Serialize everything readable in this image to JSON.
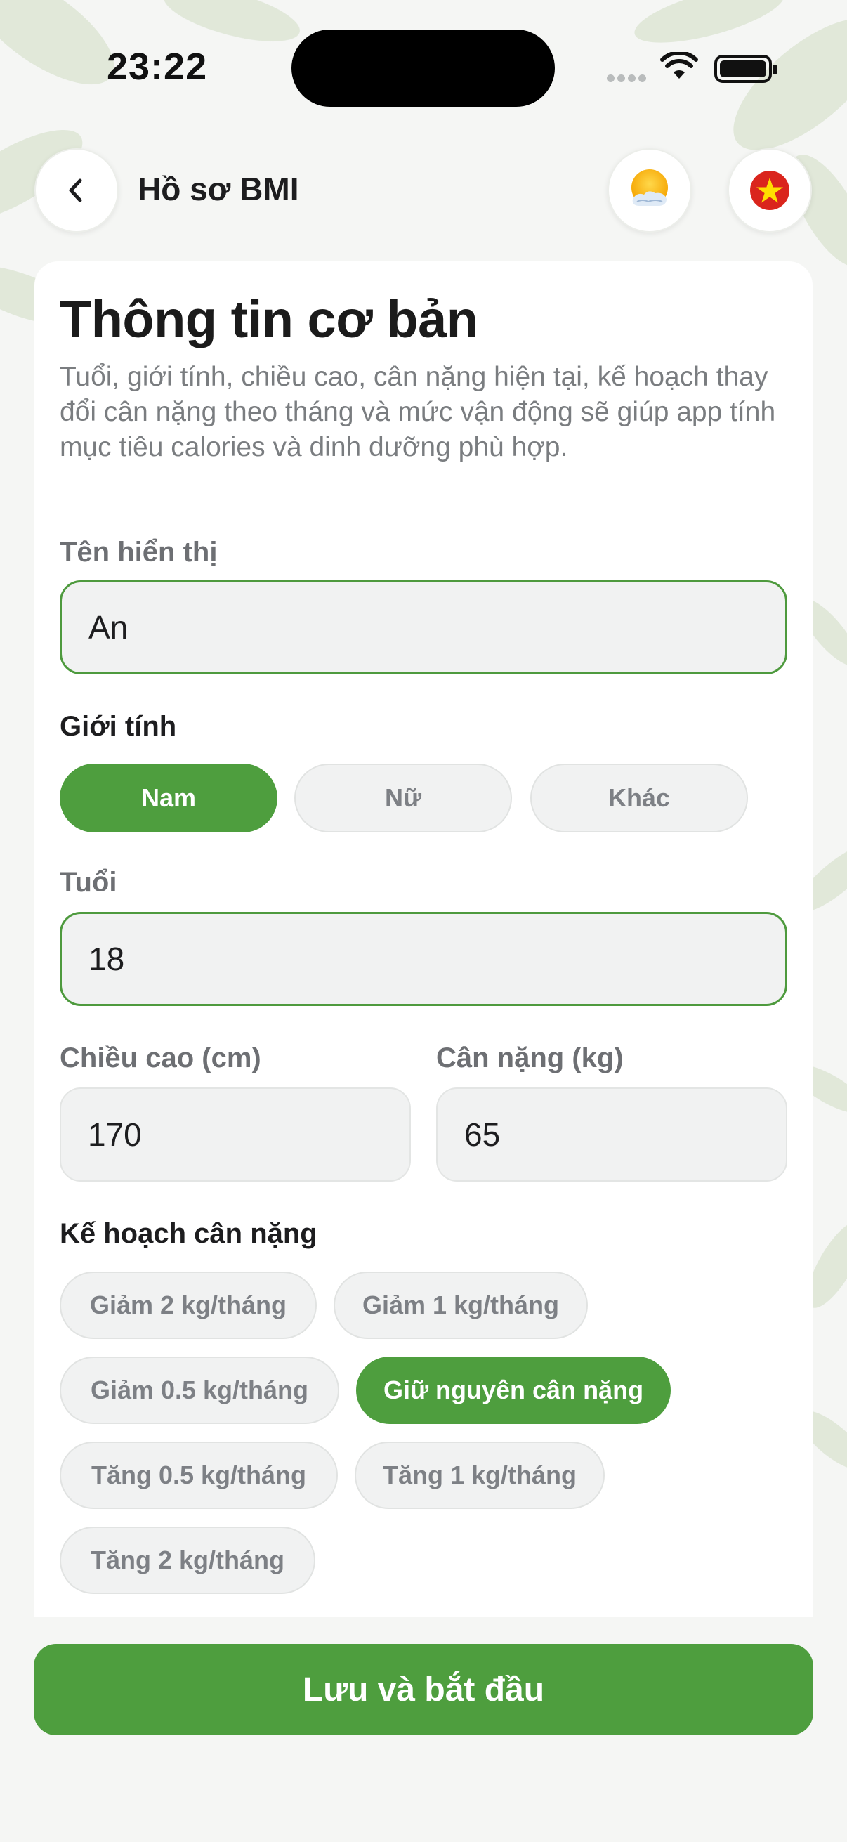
{
  "status_bar": {
    "time": "23:22"
  },
  "header": {
    "title": "Hồ sơ BMI"
  },
  "section": {
    "title": "Thông tin cơ bản",
    "description": "Tuổi, giới tính, chiều cao, cân nặng hiện tại, kế hoạch thay đổi cân nặng theo tháng và mức vận động sẽ giúp app tính mục tiêu calories và dinh dưỡng phù hợp."
  },
  "display_name": {
    "label": "Tên hiển thị",
    "value": "An"
  },
  "gender": {
    "label": "Giới tính",
    "options": [
      "Nam",
      "Nữ",
      "Khác"
    ],
    "selected": "Nam"
  },
  "age": {
    "label": "Tuổi",
    "value": "18"
  },
  "height": {
    "label": "Chiều cao (cm)",
    "value": "170"
  },
  "weight": {
    "label": "Cân nặng (kg)",
    "value": "65"
  },
  "weight_plan": {
    "label": "Kế hoạch cân nặng",
    "options": [
      "Giảm 2 kg/tháng",
      "Giảm 1 kg/tháng",
      "Giảm 0.5 kg/tháng",
      "Giữ nguyên cân nặng",
      "Tăng 0.5 kg/tháng",
      "Tăng 1 kg/tháng",
      "Tăng 2 kg/tháng"
    ],
    "selected": "Giữ nguyên cân nặng"
  },
  "save_button": {
    "label": "Lưu và bắt đầu"
  },
  "colors": {
    "accent": "#4e9e3e",
    "border_active": "#4e9a3e",
    "flag_red": "#da251d",
    "flag_star": "#ffde00"
  },
  "icons": {
    "back": "chevron-left-icon",
    "theme": "sun-cloud-icon",
    "language": "vietnam-flag-icon"
  }
}
